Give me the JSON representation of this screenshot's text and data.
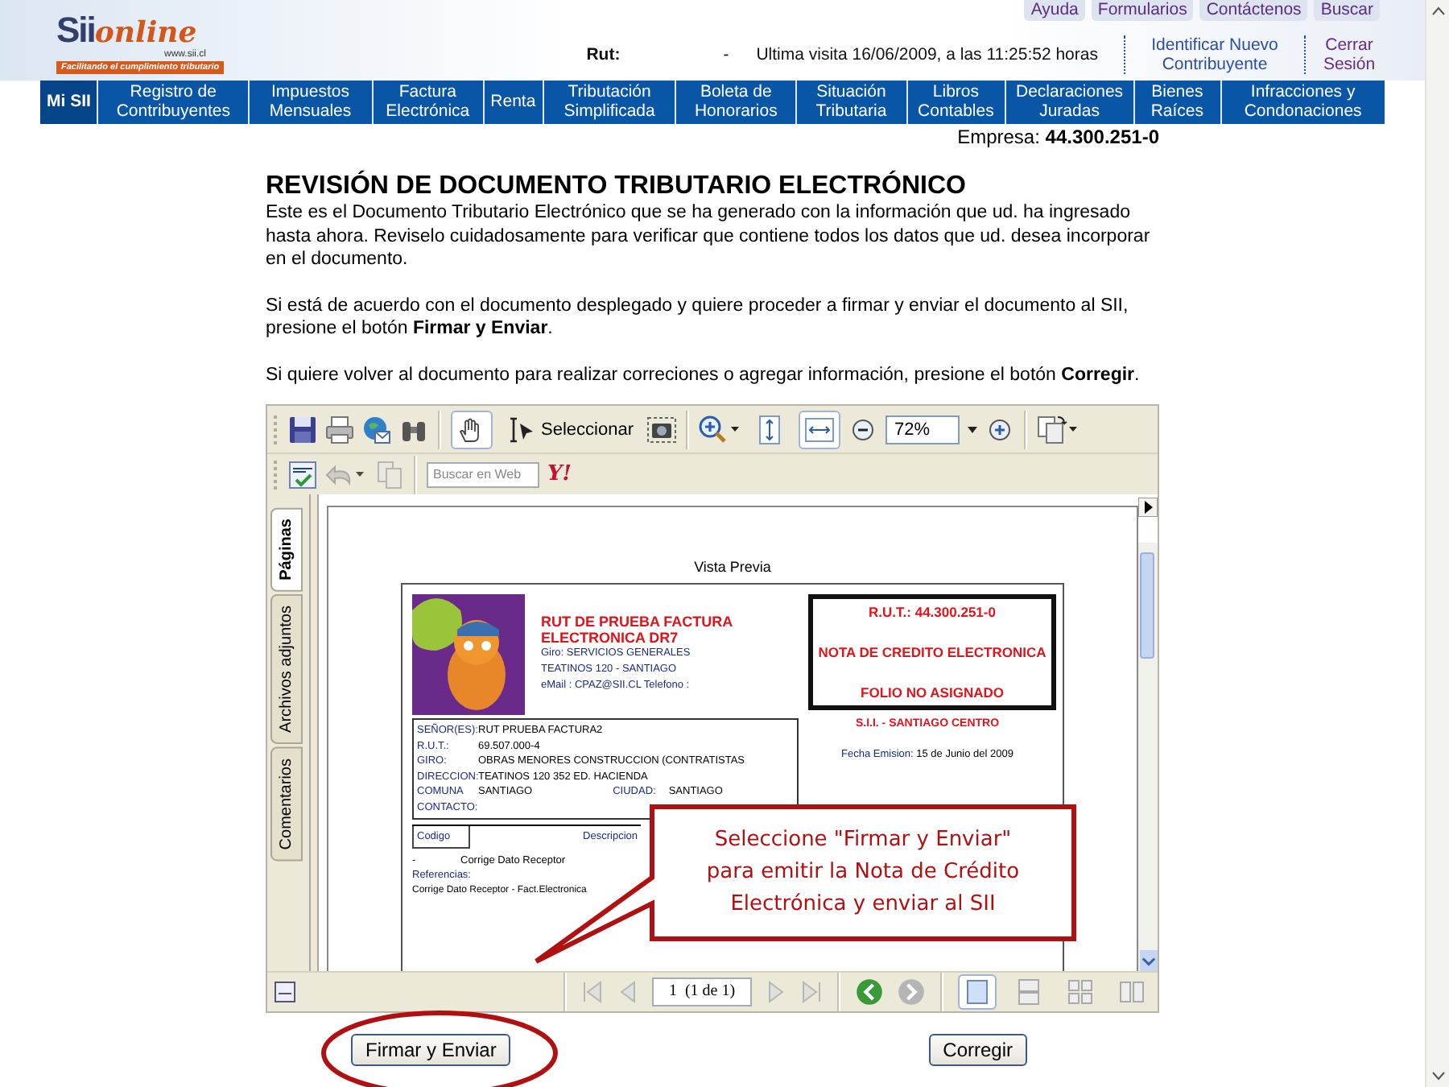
{
  "logo": {
    "brand": "Sii",
    "brand_suffix": "online",
    "site": "www.sii.cl",
    "tagline": "Facilitando el cumplimiento tributario"
  },
  "top_links": [
    "Ayuda",
    "Formularios",
    "Contáctenos",
    "Buscar"
  ],
  "session": {
    "rut_label": "Rut:",
    "rut_separator": "-",
    "last_visit": "Ultima visita 16/06/2009, a las 11:25:52 horas",
    "links": [
      {
        "label": "Identificar Nuevo Contribuyente",
        "kind": "identify"
      },
      {
        "label": "Cerrar Sesión",
        "kind": "logout"
      }
    ]
  },
  "nav": [
    {
      "label": "Mi SII",
      "selected": true
    },
    {
      "label": "Registro de Contribuyentes",
      "selected": false
    },
    {
      "label": "Impuestos Mensuales",
      "selected": false
    },
    {
      "label": "Factura Electrónica",
      "selected": false
    },
    {
      "label": "Renta",
      "selected": false
    },
    {
      "label": "Tributación Simplificada",
      "selected": false
    },
    {
      "label": "Boleta de Honorarios",
      "selected": false
    },
    {
      "label": "Situación Tributaria",
      "selected": false
    },
    {
      "label": "Libros Contables",
      "selected": false
    },
    {
      "label": "Declaraciones Juradas",
      "selected": false
    },
    {
      "label": "Bienes Raíces",
      "selected": false
    },
    {
      "label": "Infracciones y Condonaciones",
      "selected": false
    }
  ],
  "empresa": {
    "label": "Empresa:",
    "value": "44.300.251-0"
  },
  "title": "REVISIÓN DE DOCUMENTO TRIBUTARIO ELECTRÓNICO",
  "paragraphs": [
    "Este es el Documento Tributario Electrónico que se ha generado con la información que ud. ha ingresado hasta ahora. Reviselo cuidadosamente para verificar que contiene todos los datos que ud. desea incorporar en el documento.",
    "Si está de acuerdo con el documento desplegado y quiere proceder a firmar y enviar el documento al SII, presione el botón **Firmar y Enviar**.",
    "Si quiere volver al documento para realizar correciones o agregar información, presione el botón **Corregir**."
  ],
  "viewer": {
    "hand_tool": {
      "selected": true
    },
    "select_tool": {
      "label": "Seleccionar",
      "selected": false
    },
    "fit_height": {
      "selected": false
    },
    "fit_width": {
      "selected": true
    },
    "zoom": "72%",
    "search_placeholder": "Buscar en Web",
    "search_logo": "Y!",
    "side_tabs": [
      {
        "label": "Páginas",
        "selected": true
      },
      {
        "label": "Archivos adjuntos",
        "selected": false
      },
      {
        "label": "Comentarios",
        "selected": false
      }
    ],
    "page_field": "1  (1 de 1)",
    "page_views": [
      {
        "kind": "single",
        "selected": true
      },
      {
        "kind": "continuous",
        "selected": false
      },
      {
        "kind": "grid",
        "selected": false
      },
      {
        "kind": "facing",
        "selected": false
      }
    ]
  },
  "document": {
    "heading": "Vista Previa",
    "issuer": {
      "name": "RUT DE PRUEBA FACTURA ELECTRONICA DR7",
      "lines": [
        "Giro: SERVICIOS GENERALES",
        "TEATINOS 120 - SANTIAGO",
        "eMail : CPAZ@SII.CL Telefono :"
      ]
    },
    "rut_box": [
      "R.U.T.: 44.300.251-0",
      "NOTA DE CREDITO ELECTRONICA",
      "FOLIO NO ASIGNADO"
    ],
    "office": "S.I.I. - SANTIAGO CENTRO",
    "issue_date": {
      "label": "Fecha Emision:",
      "value": "15 de Junio del 2009"
    },
    "receiver": [
      {
        "label": "SEÑOR(ES):",
        "value": "RUT PRUEBA FACTURA2"
      },
      {
        "label": "R.U.T.:",
        "value": "69.507.000-4"
      },
      {
        "label": "GIRO:",
        "value": "OBRAS MENORES CONSTRUCCION (CONTRATISTAS"
      },
      {
        "label": "DIRECCION:",
        "value": "TEATINOS 120 352 ED. HACIENDA"
      },
      {
        "label": "COMUNA",
        "value": "SANTIAGO",
        "extra_label": "CIUDAD:",
        "extra_value": "SANTIAGO"
      },
      {
        "label": "CONTACTO:"
      }
    ],
    "detail_columns": [
      "Codigo",
      "Descripcion"
    ],
    "detail_row": [
      "-",
      "Corrige Dato Receptor"
    ],
    "references_label": "Referencias:",
    "reference": "Corrige Dato Receptor - Fact.Electronica"
  },
  "callout": [
    "Seleccione \"Firmar y Enviar\"",
    "para emitir la Nota de Crédito",
    "Electrónica y enviar al SII"
  ],
  "buttons": [
    {
      "label": "Firmar y Enviar",
      "highlighted": true
    },
    {
      "label": "Corregir",
      "highlighted": false
    }
  ]
}
